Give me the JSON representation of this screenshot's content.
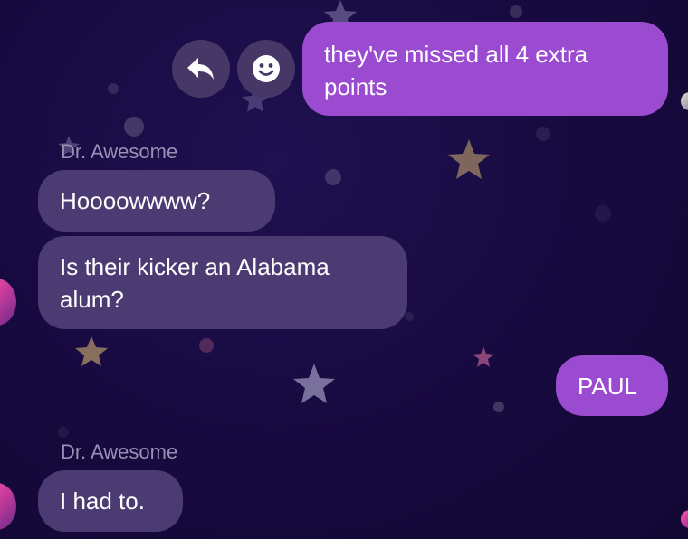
{
  "messages": [
    {
      "direction": "outgoing",
      "text": "they've missed all 4 extra points"
    },
    {
      "direction": "incoming",
      "sender": "Dr. Awesome",
      "text": "Hoooowwww?"
    },
    {
      "direction": "incoming",
      "text": "Is their kicker an Alabama alum?"
    },
    {
      "direction": "outgoing",
      "text": "PAUL"
    },
    {
      "direction": "incoming",
      "sender": "Dr. Awesome",
      "text": "I had to."
    }
  ],
  "actions": {
    "reply_icon": "reply-arrow",
    "react_icon": "smiley-face"
  },
  "colors": {
    "background": "#170a3f",
    "incoming_bubble": "#4b3b72",
    "outgoing_bubble": "#9b4bcf",
    "sender_name": "#9a8fb5"
  }
}
